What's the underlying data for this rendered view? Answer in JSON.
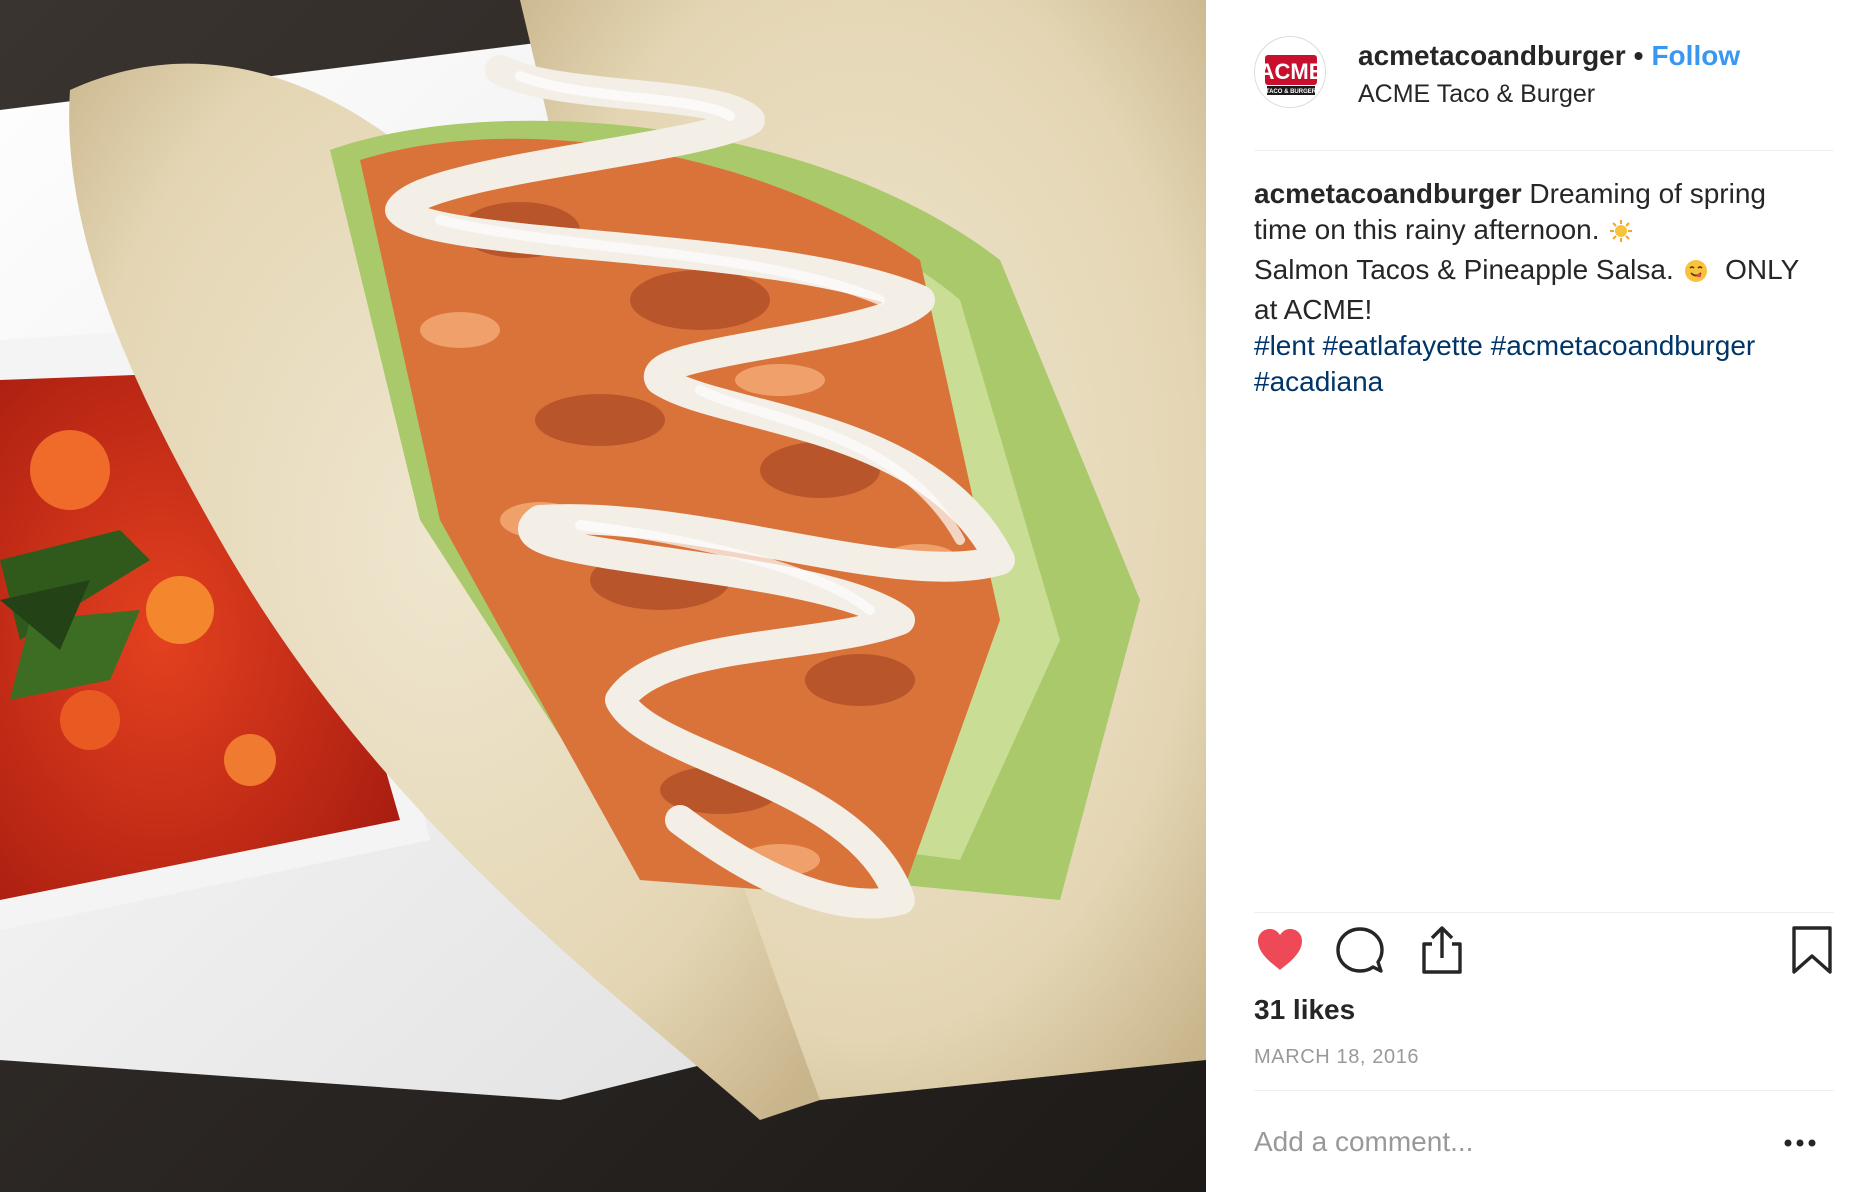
{
  "post": {
    "image_alt": "Salmon tacos with lettuce and white sauce next to pineapple salsa",
    "author": {
      "username": "acmetacoandburger",
      "avatar_text": "ACME",
      "avatar_subtext": "TACO & BURGER"
    },
    "separator": "•",
    "follow_label": "Follow",
    "location": "ACME Taco & Burger",
    "caption": {
      "username": "acmetacoandburger",
      "line1": "Dreaming of spring time on this rainy afternoon.",
      "line2": "Salmon Tacos & Pineapple Salsa.",
      "line3": "ONLY at ACME!",
      "hashtags": [
        "#lent",
        "#eatlafayette",
        "#acmetacoandburger",
        "#acadiana"
      ]
    },
    "icons": {
      "like": "heart-icon",
      "comment": "comment-icon",
      "share": "share-icon",
      "save": "bookmark-icon",
      "more": "more-options-icon"
    },
    "liked": true,
    "likes": "31 likes",
    "date": "MARCH 18, 2016",
    "comment_placeholder": "Add a comment..."
  },
  "colors": {
    "follow": "#3897f0",
    "hashtag": "#003569",
    "heart": "#ed4956",
    "muted": "#999999",
    "avatar_red": "#c8102e"
  }
}
